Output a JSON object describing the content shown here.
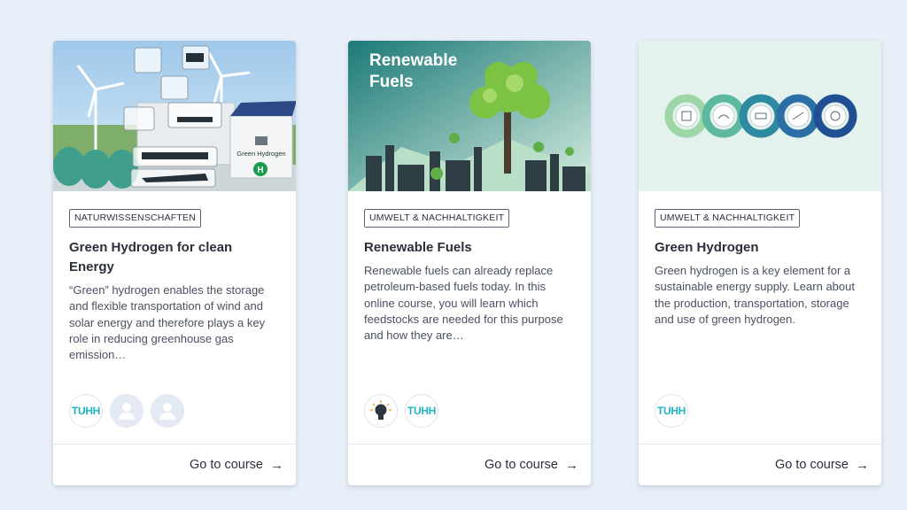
{
  "courses": [
    {
      "tag": "NATURWISSENSCHAFTEN",
      "title": "Green Hydrogen for clean Energy",
      "description": "“Green” hydrogen enables the storage and flexible transportation of wind and solar energy and therefore plays a key role in reducing greenhouse gas emission…",
      "thumb_text": "Green Hydrogen",
      "avatars": [
        "TUHH",
        "person",
        "person"
      ],
      "cta": "Go to course",
      "cta_icon": "arrow-right-icon"
    },
    {
      "tag": "UMWELT & NACHHALTIGKEIT",
      "title": "Renewable Fuels",
      "description": "Renewable fuels can already replace petroleum-based fuels today. In this online course, you will learn which feedstocks are needed for this purpose and how they are…",
      "thumb_text_1": "Renewable",
      "thumb_text_2": "Fuels",
      "avatars": [
        "lightbulb",
        "TUHH"
      ],
      "cta": "Go to course",
      "cta_icon": "arrow-right-icon"
    },
    {
      "tag": "UMWELT & NACHHALTIGKEIT",
      "title": "Green Hydrogen",
      "description": "Green hydrogen is a key element for a sustainable energy supply. Learn about the production, transportation, storage and use of green hydrogen.",
      "avatars": [
        "TUHH"
      ],
      "cta": "Go to course",
      "cta_icon": "arrow-right-icon"
    }
  ],
  "avatar_label": "TUHH",
  "colors": {
    "background": "#e9eff9",
    "tuhh": "#1fb3c3",
    "chain_1": "#9fd6a8",
    "chain_2": "#5cb9a0",
    "chain_3": "#2e8aa0",
    "chain_4": "#2c6fa6",
    "chain_5": "#204f93"
  }
}
